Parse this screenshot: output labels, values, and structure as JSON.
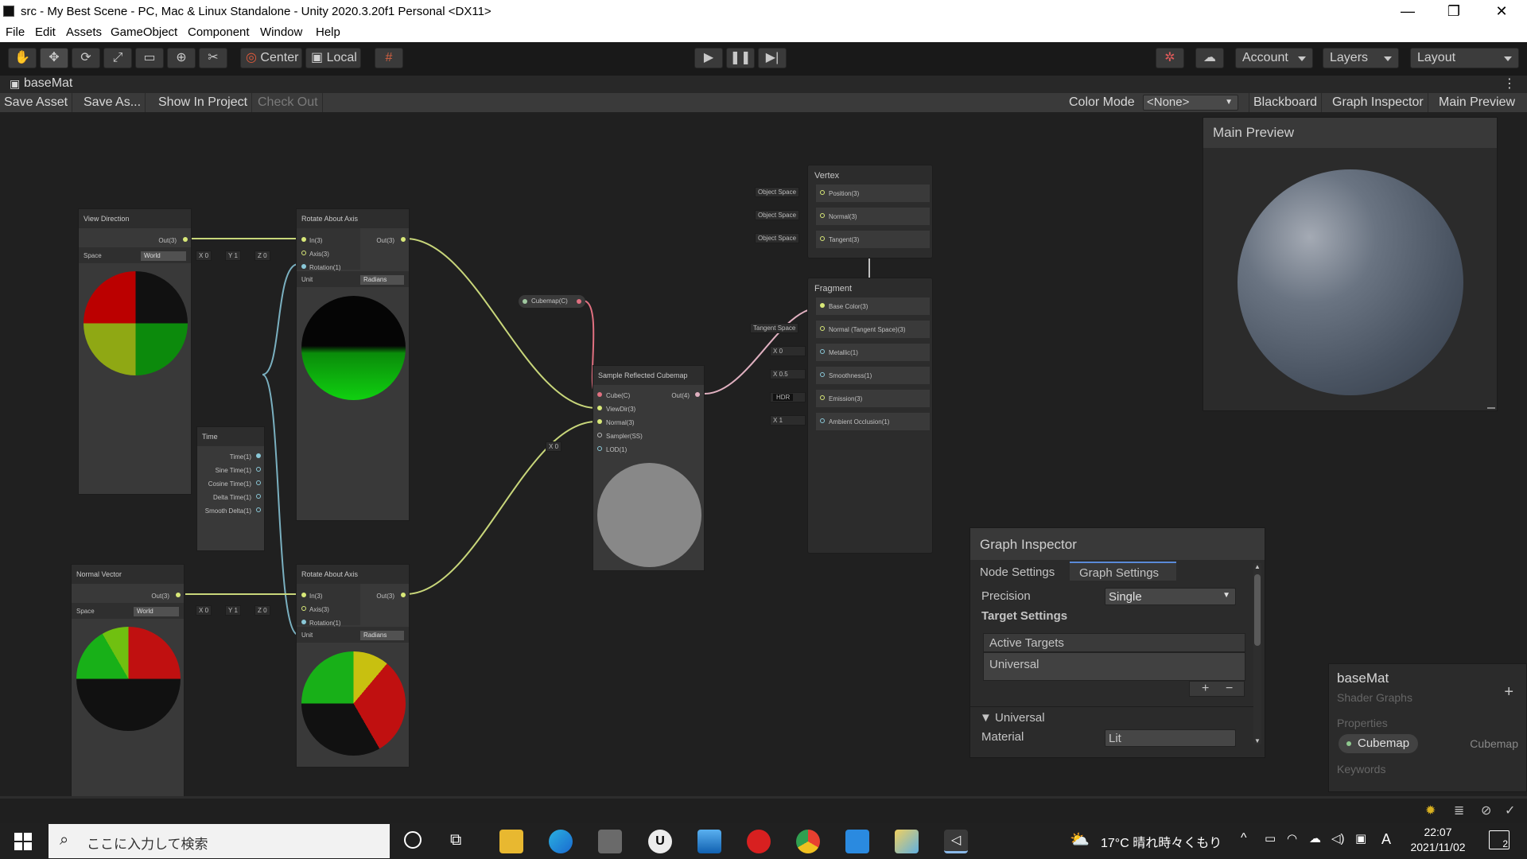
{
  "window": {
    "title": "src - My Best Scene - PC, Mac & Linux Standalone - Unity 2020.3.20f1 Personal <DX11>",
    "controls": [
      "—",
      "❐",
      "✕"
    ]
  },
  "menu": [
    "File",
    "Edit",
    "Assets",
    "GameObject",
    "Component",
    "Window",
    "Help"
  ],
  "toolbar": {
    "pivot": "Center",
    "space": "Local",
    "account": "Account",
    "layers": "Layers",
    "layout": "Layout"
  },
  "tab": {
    "title": "baseMat"
  },
  "graph_toolbar": {
    "save_asset": "Save Asset",
    "save_as": "Save As...",
    "show_in_project": "Show In Project",
    "check_out": "Check Out",
    "color_mode_label": "Color Mode",
    "color_mode_value": "<None>",
    "blackboard": "Blackboard",
    "graph_inspector": "Graph Inspector",
    "main_preview": "Main Preview"
  },
  "nodes": {
    "view_direction": {
      "title": "View Direction",
      "out": "Out(3)",
      "space_label": "Space",
      "space_value": "World"
    },
    "rotate1": {
      "title": "Rotate About Axis",
      "in": "In(3)",
      "axis": "Axis(3)",
      "rotation": "Rotation(1)",
      "out": "Out(3)",
      "unit_label": "Unit",
      "unit_value": "Radians"
    },
    "axis_ctl1": {
      "x_label": "X",
      "x": "0",
      "y_label": "Y",
      "y": "1",
      "z_label": "Z",
      "z": "0"
    },
    "time": {
      "title": "Time",
      "outputs": [
        "Time(1)",
        "Sine Time(1)",
        "Cosine Time(1)",
        "Delta Time(1)",
        "Smooth Delta(1)"
      ]
    },
    "normal_vector": {
      "title": "Normal Vector",
      "out": "Out(3)",
      "space_label": "Space",
      "space_value": "World"
    },
    "rotate2": {
      "title": "Rotate About Axis",
      "in": "In(3)",
      "axis": "Axis(3)",
      "rotation": "Rotation(1)",
      "out": "Out(3)",
      "unit_label": "Unit",
      "unit_value": "Radians"
    },
    "axis_ctl2": {
      "x_label": "X",
      "x": "0",
      "y_label": "Y",
      "y": "1",
      "z_label": "Z",
      "z": "0"
    },
    "cubemap_prop": {
      "label": "Cubemap(C)"
    },
    "sample_cubemap": {
      "title": "Sample Reflected Cubemap",
      "inputs": [
        "Cube(C)",
        "ViewDir(3)",
        "Normal(3)",
        "Sampler(SS)",
        "LOD(1)"
      ],
      "out": "Out(4)",
      "lod_label": "X",
      "lod_value": "0"
    },
    "vertex": {
      "title": "Vertex",
      "slots": [
        "Position(3)",
        "Normal(3)",
        "Tangent(3)"
      ],
      "space_ctl": [
        "Object Space",
        "Object Space",
        "Object Space"
      ]
    },
    "fragment": {
      "title": "Fragment",
      "slots": [
        "Base Color(3)",
        "Normal (Tangent Space)(3)",
        "Metallic(1)",
        "Smoothness(1)",
        "Emission(3)",
        "Ambient Occlusion(1)"
      ],
      "normal_ctl": "Tangent Space",
      "metallic_label": "X",
      "metallic_value": "0",
      "smoothness_label": "X",
      "smoothness_value": "0.5",
      "emission_ctl": "HDR",
      "ao_label": "X",
      "ao_value": "1"
    }
  },
  "main_preview": {
    "title": "Main Preview"
  },
  "graph_inspector": {
    "title": "Graph Inspector",
    "tab_node": "Node Settings",
    "tab_graph": "Graph Settings",
    "precision_label": "Precision",
    "precision_value": "Single",
    "target_settings": "Target Settings",
    "active_targets": "Active Targets",
    "target_item": "Universal",
    "add": "+",
    "remove": "−",
    "foldout": "Universal",
    "material_label": "Material",
    "material_value": "Lit"
  },
  "blackboard": {
    "title": "baseMat",
    "subtitle": "Shader Graphs",
    "add": "+",
    "properties_label": "Properties",
    "property_name": "Cubemap",
    "property_type": "Cubemap",
    "keywords_label": "Keywords"
  },
  "taskbar": {
    "search_placeholder": "ここに入力して検索",
    "weather": "17°C 晴れ時々くもり",
    "ime": "A",
    "time": "22:07",
    "date": "2021/11/02",
    "notifications": "2"
  }
}
